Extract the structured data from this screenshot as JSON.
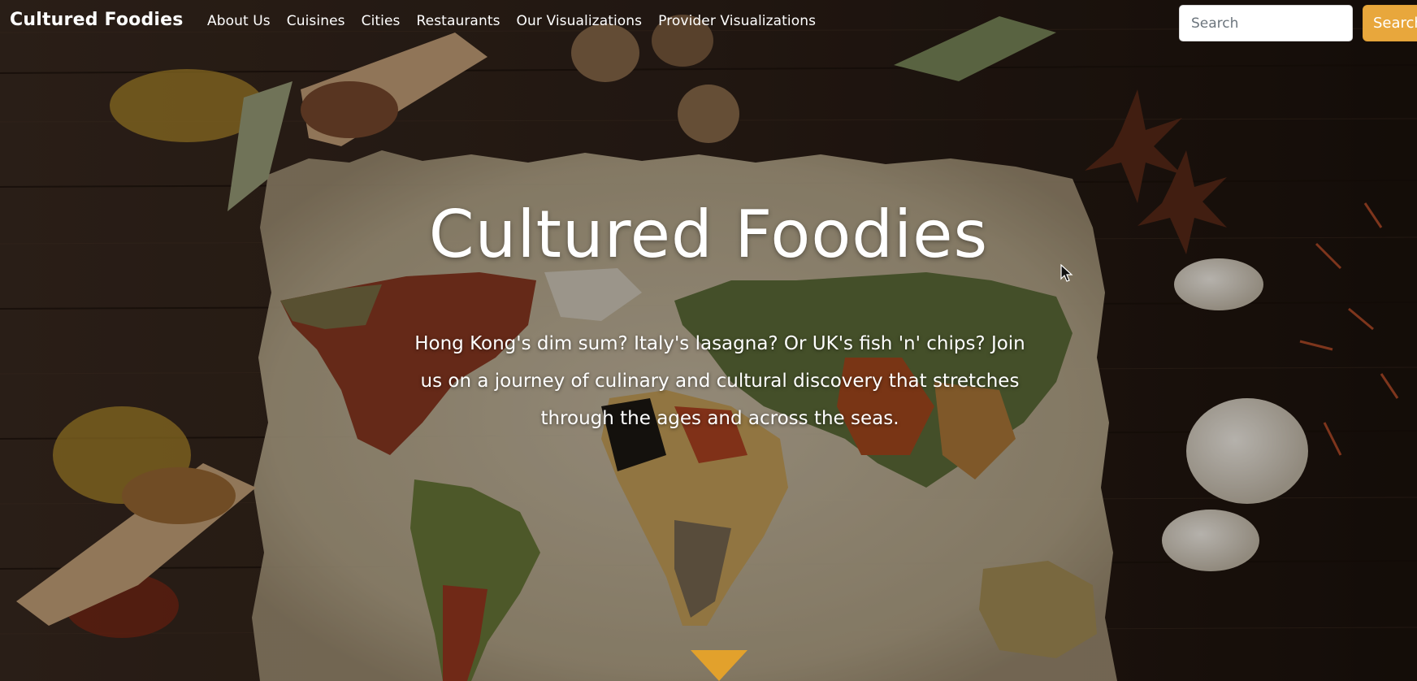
{
  "navbar": {
    "brand": "Cultured Foodies",
    "links": [
      {
        "label": "About Us"
      },
      {
        "label": "Cuisines"
      },
      {
        "label": "Cities"
      },
      {
        "label": "Restaurants"
      },
      {
        "label": "Our Visualizations"
      },
      {
        "label": "Provider Visualizations"
      }
    ],
    "search": {
      "placeholder": "Search",
      "value": "",
      "button_label": "Search"
    }
  },
  "hero": {
    "title": "Cultured Foodies",
    "subtitle": "Hong Kong's dim sum? Italy's lasagna? Or UK's fish 'n' chips? Join us on a journey of culinary and cultural discovery that stretches through the ages and across the seas.",
    "scroll_icon": "triangle-down-icon"
  },
  "colors": {
    "accent": "#e8a73c",
    "text": "#ffffff",
    "wood": "#2a1c14",
    "parchment": "#cdbfa3"
  }
}
